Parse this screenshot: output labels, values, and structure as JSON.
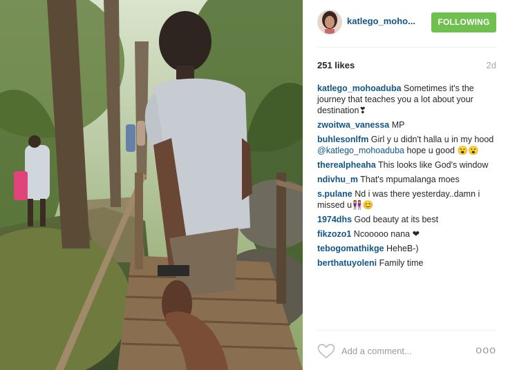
{
  "post": {
    "username": "katlego_moho...",
    "follow_label": "FOLLOWING",
    "likes": "251 likes",
    "time_ago": "2d"
  },
  "comments": [
    {
      "user": "katlego_mohoaduba",
      "text": " Sometimes it's the journey that teaches you a lot about your destination❣"
    },
    {
      "user": "zwoitwa_vanessa",
      "text": " MP"
    },
    {
      "user": "buhlesonlfm",
      "text": " Girl y u didn't halla u in my hood ",
      "mention": "@katlego_mohoaduba",
      "text_after": " hope u good 😮😮"
    },
    {
      "user": "therealpheaha",
      "text": " This looks like God's window"
    },
    {
      "user": "ndivhu_m",
      "text": " That's mpumalanga moes"
    },
    {
      "user": "s.pulane",
      "text": " Nd i was there yesterday..damn i missed u👭😊"
    },
    {
      "user": "1974dhs",
      "text": " God beauty at its best"
    },
    {
      "user": "fikzozo1",
      "text": " Ncooooo nana ❤"
    },
    {
      "user": "tebogomathikge",
      "text": " HeheB-)"
    },
    {
      "user": "berthatuyoleni",
      "text": " Family time"
    }
  ],
  "footer": {
    "add_comment_placeholder": "Add a comment...",
    "more_label": "ooo"
  },
  "icons": {
    "heart": "heart-icon",
    "more": "more-options-icon"
  },
  "colors": {
    "follow_green": "#70c050",
    "username_blue": "#125688"
  }
}
